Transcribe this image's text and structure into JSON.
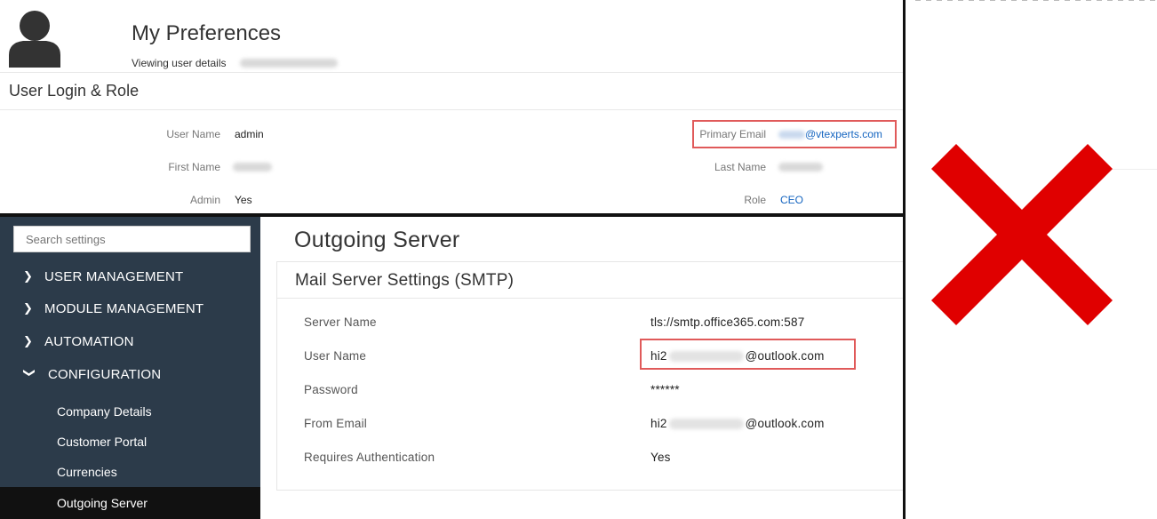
{
  "preferences": {
    "title": "My Preferences",
    "subtitle": "Viewing user details",
    "section_title": "User Login & Role",
    "fields": {
      "user_name_label": "User Name",
      "user_name_value": "admin",
      "first_name_label": "First Name",
      "admin_label": "Admin",
      "admin_value": "Yes",
      "primary_email_label": "Primary Email",
      "primary_email_value": "@vtexperts.com",
      "last_name_label": "Last Name",
      "role_label": "Role",
      "role_value": "CEO"
    }
  },
  "sidebar": {
    "search_placeholder": "Search settings",
    "sections": [
      {
        "label": "USER MANAGEMENT",
        "icon": "chevron-right-icon"
      },
      {
        "label": "MODULE MANAGEMENT",
        "icon": "chevron-right-icon"
      },
      {
        "label": "AUTOMATION",
        "icon": "chevron-right-icon"
      },
      {
        "label": "CONFIGURATION",
        "icon": "chevron-down-icon"
      }
    ],
    "sub_items": [
      {
        "label": "Company Details"
      },
      {
        "label": "Customer Portal"
      },
      {
        "label": "Currencies"
      },
      {
        "label": "Outgoing Server",
        "active": true
      }
    ]
  },
  "outgoing": {
    "page_title": "Outgoing Server",
    "card_title": "Mail Server Settings (SMTP)",
    "rows": [
      {
        "label": "Server Name",
        "value": "tls://smtp.office365.com:587"
      },
      {
        "label": "User Name",
        "value_prefix": "hi2",
        "value_suffix": "@outlook.com"
      },
      {
        "label": "Password",
        "value": "******"
      },
      {
        "label": "From Email",
        "value_prefix": "hi2",
        "value_suffix": "@outlook.com"
      },
      {
        "label": "Requires Authentication",
        "value": "Yes"
      }
    ]
  },
  "colors": {
    "sidebar_bg": "#2c3b4a",
    "active_item_bg": "#111111",
    "link": "#1565c0",
    "highlight_box": "#e05a5a",
    "cross": "#e00000"
  }
}
